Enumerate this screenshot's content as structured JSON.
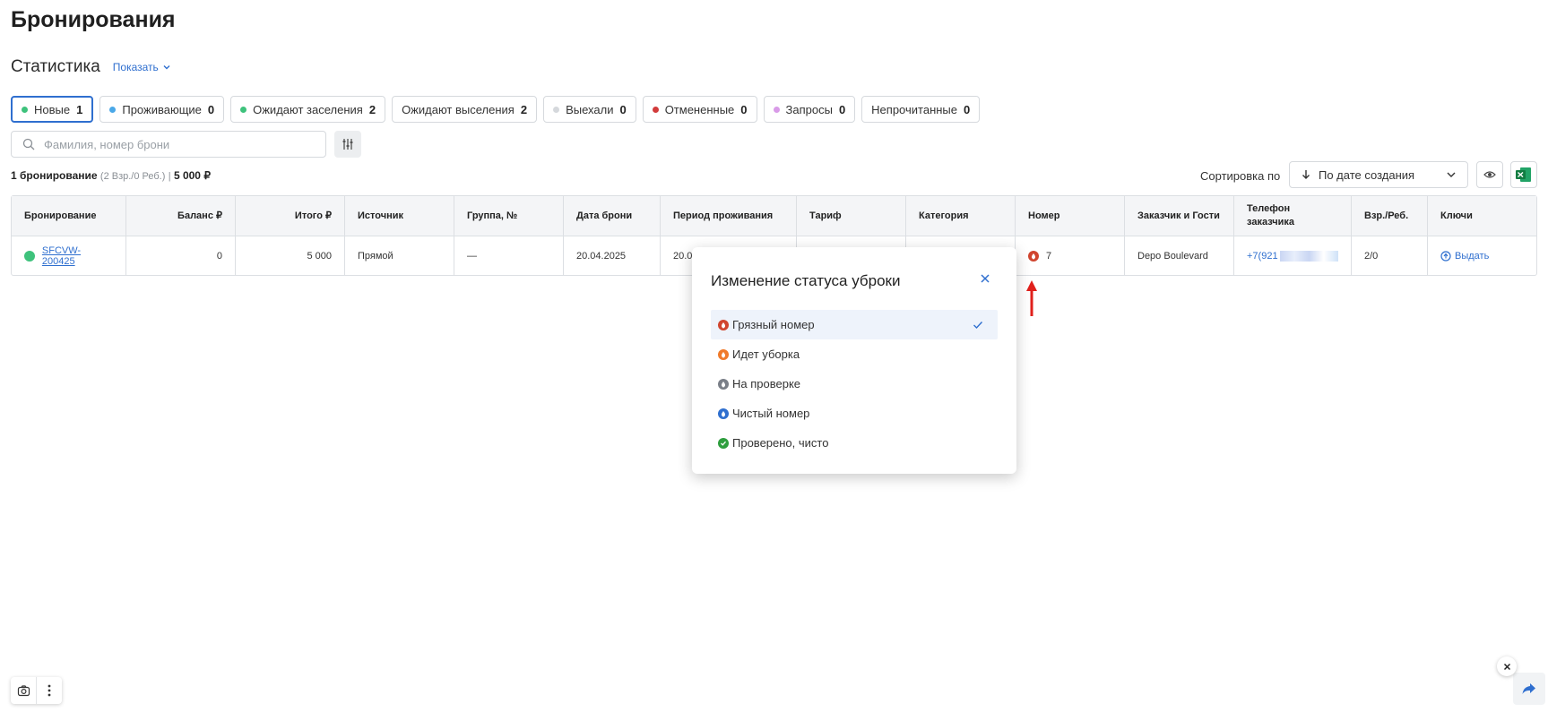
{
  "page": {
    "title": "Бронирования"
  },
  "stats": {
    "title": "Статистика",
    "show_label": "Показать"
  },
  "tabs": [
    {
      "label": "Новые",
      "count": "1",
      "dot": "#3ec27c"
    },
    {
      "label": "Проживающие",
      "count": "0",
      "dot": "#4aa8e8"
    },
    {
      "label": "Ожидают заселения",
      "count": "2",
      "dot": "#3ec27c"
    },
    {
      "label": "Ожидают выселения",
      "count": "2",
      "dot": ""
    },
    {
      "label": "Выехали",
      "count": "0",
      "dot": "#d5d8dc"
    },
    {
      "label": "Отмененные",
      "count": "0",
      "dot": "#d23b3b"
    },
    {
      "label": "Запросы",
      "count": "0",
      "dot": "#d99be8"
    },
    {
      "label": "Непрочитанные",
      "count": "0",
      "dot": ""
    }
  ],
  "search": {
    "placeholder": "Фамилия, номер брони"
  },
  "summary": {
    "count_text": "1 бронирование",
    "guests_text": "(2 Взр./0 Реб.)",
    "separator": "|",
    "total_text": "5 000 ₽"
  },
  "sort": {
    "label": "Сортировка по",
    "value": "По дате создания"
  },
  "table": {
    "headers": [
      "Бронирование",
      "Баланс ₽",
      "Итого ₽",
      "Источник",
      "Группа, №",
      "Дата брони",
      "Период проживания",
      "Тариф",
      "Категория",
      "Номер",
      "Заказчик и Гости",
      "Телефон заказчика",
      "Взр./Реб.",
      "Ключи"
    ],
    "row": {
      "booking_id": "SFCVW-200425",
      "balance": "0",
      "total": "5 000",
      "source": "Прямой",
      "group": "—",
      "date": "20.04.2025",
      "period": "20.0",
      "tariff": "",
      "category": "",
      "room": "7",
      "customer": "Depo Boulevard",
      "phone": "+7(921",
      "guests": "2/0",
      "keys_label": "Выдать"
    }
  },
  "modal": {
    "title": "Изменение статуса уброки",
    "options": [
      {
        "label": "Грязный номер",
        "color": "#d0452f",
        "selected": true
      },
      {
        "label": "Идет уборка",
        "color": "#f07a2a",
        "selected": false
      },
      {
        "label": "На проверке",
        "color": "#7a7f88",
        "selected": false
      },
      {
        "label": "Чистый номер",
        "color": "#2f6fcf",
        "selected": false
      },
      {
        "label": "Проверено, чисто",
        "color": "#2e9e3e",
        "selected": false
      }
    ]
  },
  "icons": {
    "search": "search-icon",
    "filter": "sliders-icon",
    "sort": "arrow-down-icon",
    "eye": "eye-icon",
    "excel": "excel-icon",
    "close": "close-icon",
    "check": "check-icon",
    "share": "share-arrow-icon",
    "camera": "camera-icon",
    "more": "more-vertical-icon"
  },
  "colors": {
    "accent": "#2f6fcf",
    "annotation_arrow": "#e0201c"
  }
}
